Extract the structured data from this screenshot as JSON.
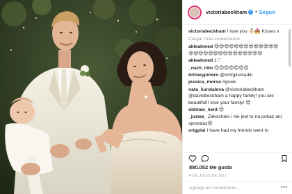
{
  "post": {
    "username": "victoriabeckham",
    "follow_label": "Seguir",
    "separator": "•",
    "caption": "I love you 👶🏻💑 Kisses x",
    "load_more": "Cargar más comentarios",
    "likes": "880.052 Me gusta",
    "date": "4 DE JULIO DE 2017",
    "add_comment_placeholder": "Agrega un comentario...",
    "more_glyph": "•••"
  },
  "comments": [
    {
      "user": "akleahmed",
      "text": "😍😍😍😍😍😍😍😍😍😍😍😍😍😍😍😍😍😍😍😍😍😍😍😍😍😍😍😍"
    },
    {
      "user": "akleahmed",
      "text": "1♡"
    },
    {
      "user": "_nazii_nbn",
      "text": "😍😍😍😍😍😍😍"
    },
    {
      "user": "britneypinero",
      "text": "@omfgitsmadiii"
    },
    {
      "user": "jessica_morse",
      "text": "#goals"
    },
    {
      "user": "nata_kundaleva",
      "text": "@victoriabeckham @davidbeckham a happy family! you are beautiful!! love your family! 😊"
    },
    {
      "user": "oldman_kent",
      "text": "😊"
    },
    {
      "user": "_juzwa_",
      "text": "Zakochani i nie jest to na pokaz ani sprzedaż😍"
    },
    {
      "user": "origpiai",
      "text": "I have had my friends went to"
    }
  ],
  "icons": {
    "avatar": "avatar",
    "verified": "verified-badge-icon",
    "like": "heart-icon",
    "comment": "comment-bubble-icon",
    "bookmark": "bookmark-icon"
  },
  "colors": {
    "link": "#3897f0",
    "text": "#262626",
    "muted": "#999999",
    "divider": "#efefef"
  }
}
